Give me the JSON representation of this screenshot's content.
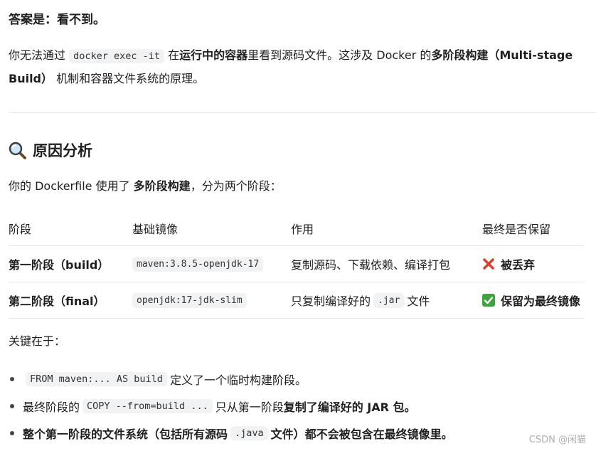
{
  "answer": "答案是：看不到。",
  "intro": {
    "p1": "你无法通过",
    "code": "docker exec -it",
    "p2": "在",
    "b1": "运行中的容器",
    "p3": "里看到源码文件。这涉及 Docker 的",
    "b2": "多阶段构建（Multi-stage Build）",
    "p4": "机制和容器文件系统的原理。"
  },
  "section": {
    "icon": "magnifier-icon",
    "title": "原因分析"
  },
  "desc": {
    "p1": "你的 Dockerfile 使用了",
    "b": "多阶段构建",
    "p2": "，分为两个阶段："
  },
  "table": {
    "headers": [
      "阶段",
      "基础镜像",
      "作用",
      "最终是否保留"
    ],
    "rows": [
      {
        "stage": "第一阶段（build）",
        "image": "maven:3.8.5-openjdk-17",
        "role": "复制源码、下载依赖、编译打包",
        "role_code": "",
        "role_suffix": "",
        "status_icon": "cross-mark-icon",
        "status": "被丢弃"
      },
      {
        "stage": "第二阶段（final）",
        "image": "openjdk:17-jdk-slim",
        "role": "只复制编译好的",
        "role_code": ".jar",
        "role_suffix": "文件",
        "status_icon": "check-mark-icon",
        "status": "保留为最终镜像"
      }
    ]
  },
  "key_intro": "关键在于：",
  "bullets": [
    {
      "code1": "FROM maven:... AS build",
      "text": "定义了一个临时构建阶段。"
    },
    {
      "prefix": "最终阶段的",
      "code": "COPY --from=build ...",
      "mid": "只从第一阶段",
      "bold": "复制了编译好的 JAR 包。"
    },
    {
      "bold1": "整个第一阶段的文件系统（包括所有源码",
      "code": ".java",
      "bold2": "文件）都不会被包含在最终镜像里。"
    }
  ],
  "watermark": "CSDN @闲猫",
  "colors": {
    "cross": "#d9412e",
    "check": "#3fa33f",
    "code_bg": "#f1f2f4"
  }
}
